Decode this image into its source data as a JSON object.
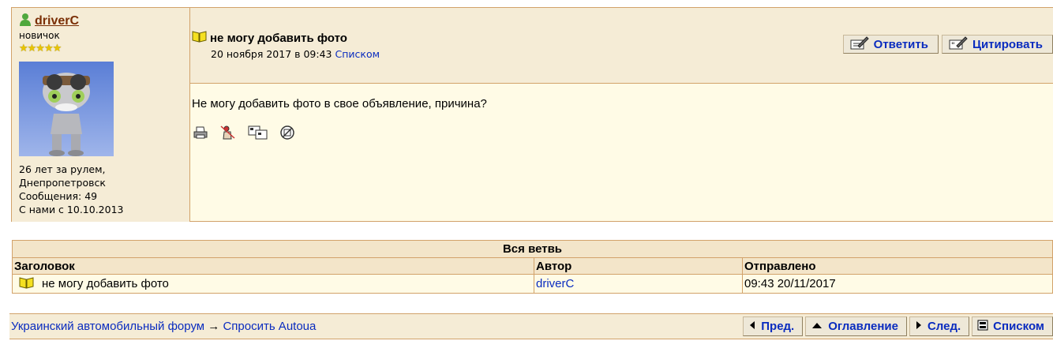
{
  "author": {
    "name": "driverC",
    "rank": "новичок",
    "stars": "★★★★★",
    "info": {
      "experience": "26 лет за рулем, Днепропетровск",
      "messages": "Сообщения: 49",
      "member_since": "С нами с 10.10.2013"
    }
  },
  "post": {
    "title": "не могу добавить фото",
    "date": "20 ноября 2017 в 09:43",
    "list_link": "Списком",
    "body": "Не могу добавить фото в свое объявление, причина?",
    "actions": {
      "reply": "Ответить",
      "quote": "Цитировать"
    },
    "tool_icons": [
      "print-icon",
      "moderate-icon",
      "screen-icon",
      "block-icon"
    ]
  },
  "thread": {
    "caption": "Вся ветвь",
    "columns": [
      "Заголовок",
      "Автор",
      "Отправлено"
    ],
    "rows": [
      {
        "title": "не могу добавить фото",
        "author": "driverC",
        "sent": "09:43 20/11/2017"
      }
    ]
  },
  "footer": {
    "breadcrumb_forum": "Украинский автомобильный форум",
    "arrow": "→",
    "breadcrumb_section": "Спросить Autoua",
    "nav": {
      "prev": "Пред.",
      "toc": "Оглавление",
      "next": "След.",
      "list": "Списком"
    }
  },
  "colors": {
    "link": "#0a2cbf",
    "username": "#7a2e05",
    "border": "#d2a26a",
    "header_bg": "#f5ecd6",
    "post_bg": "#fffbe6"
  }
}
